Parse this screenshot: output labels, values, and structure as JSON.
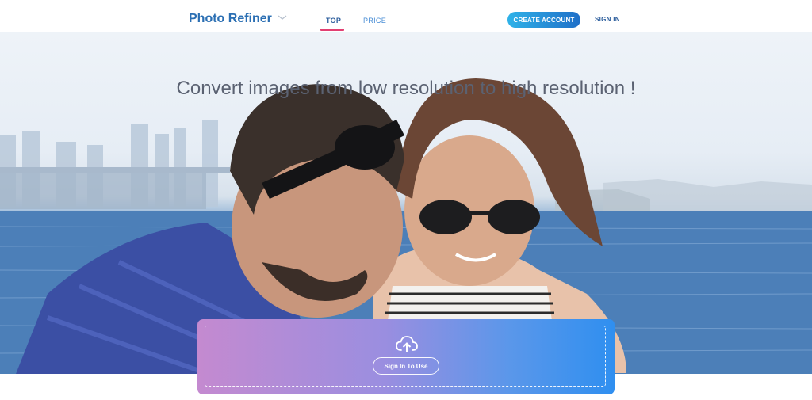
{
  "header": {
    "brand": "Photo Refiner",
    "brand_menu_icon": "chevron-down-icon",
    "nav": [
      {
        "label": "TOP",
        "active": true
      },
      {
        "label": "PRICE",
        "active": false
      }
    ],
    "create_account": "CREATE ACCOUNT",
    "sign_in": "SIGN IN"
  },
  "hero": {
    "title": "Convert images from low resolution to high resolution !",
    "image": "couple-in-sunglasses-by-harbor-photo"
  },
  "upload": {
    "icon": "cloud-upload-icon",
    "button": "Sign In To Use"
  },
  "colors": {
    "brand": "#2b6fb3",
    "active_tab_underline": "#e23f72",
    "button_gradient_start": "#2fb2e8",
    "button_gradient_end": "#1f6fc8",
    "panel_gradient_start": "#c48ad0",
    "panel_gradient_end": "#2f8ff0"
  }
}
